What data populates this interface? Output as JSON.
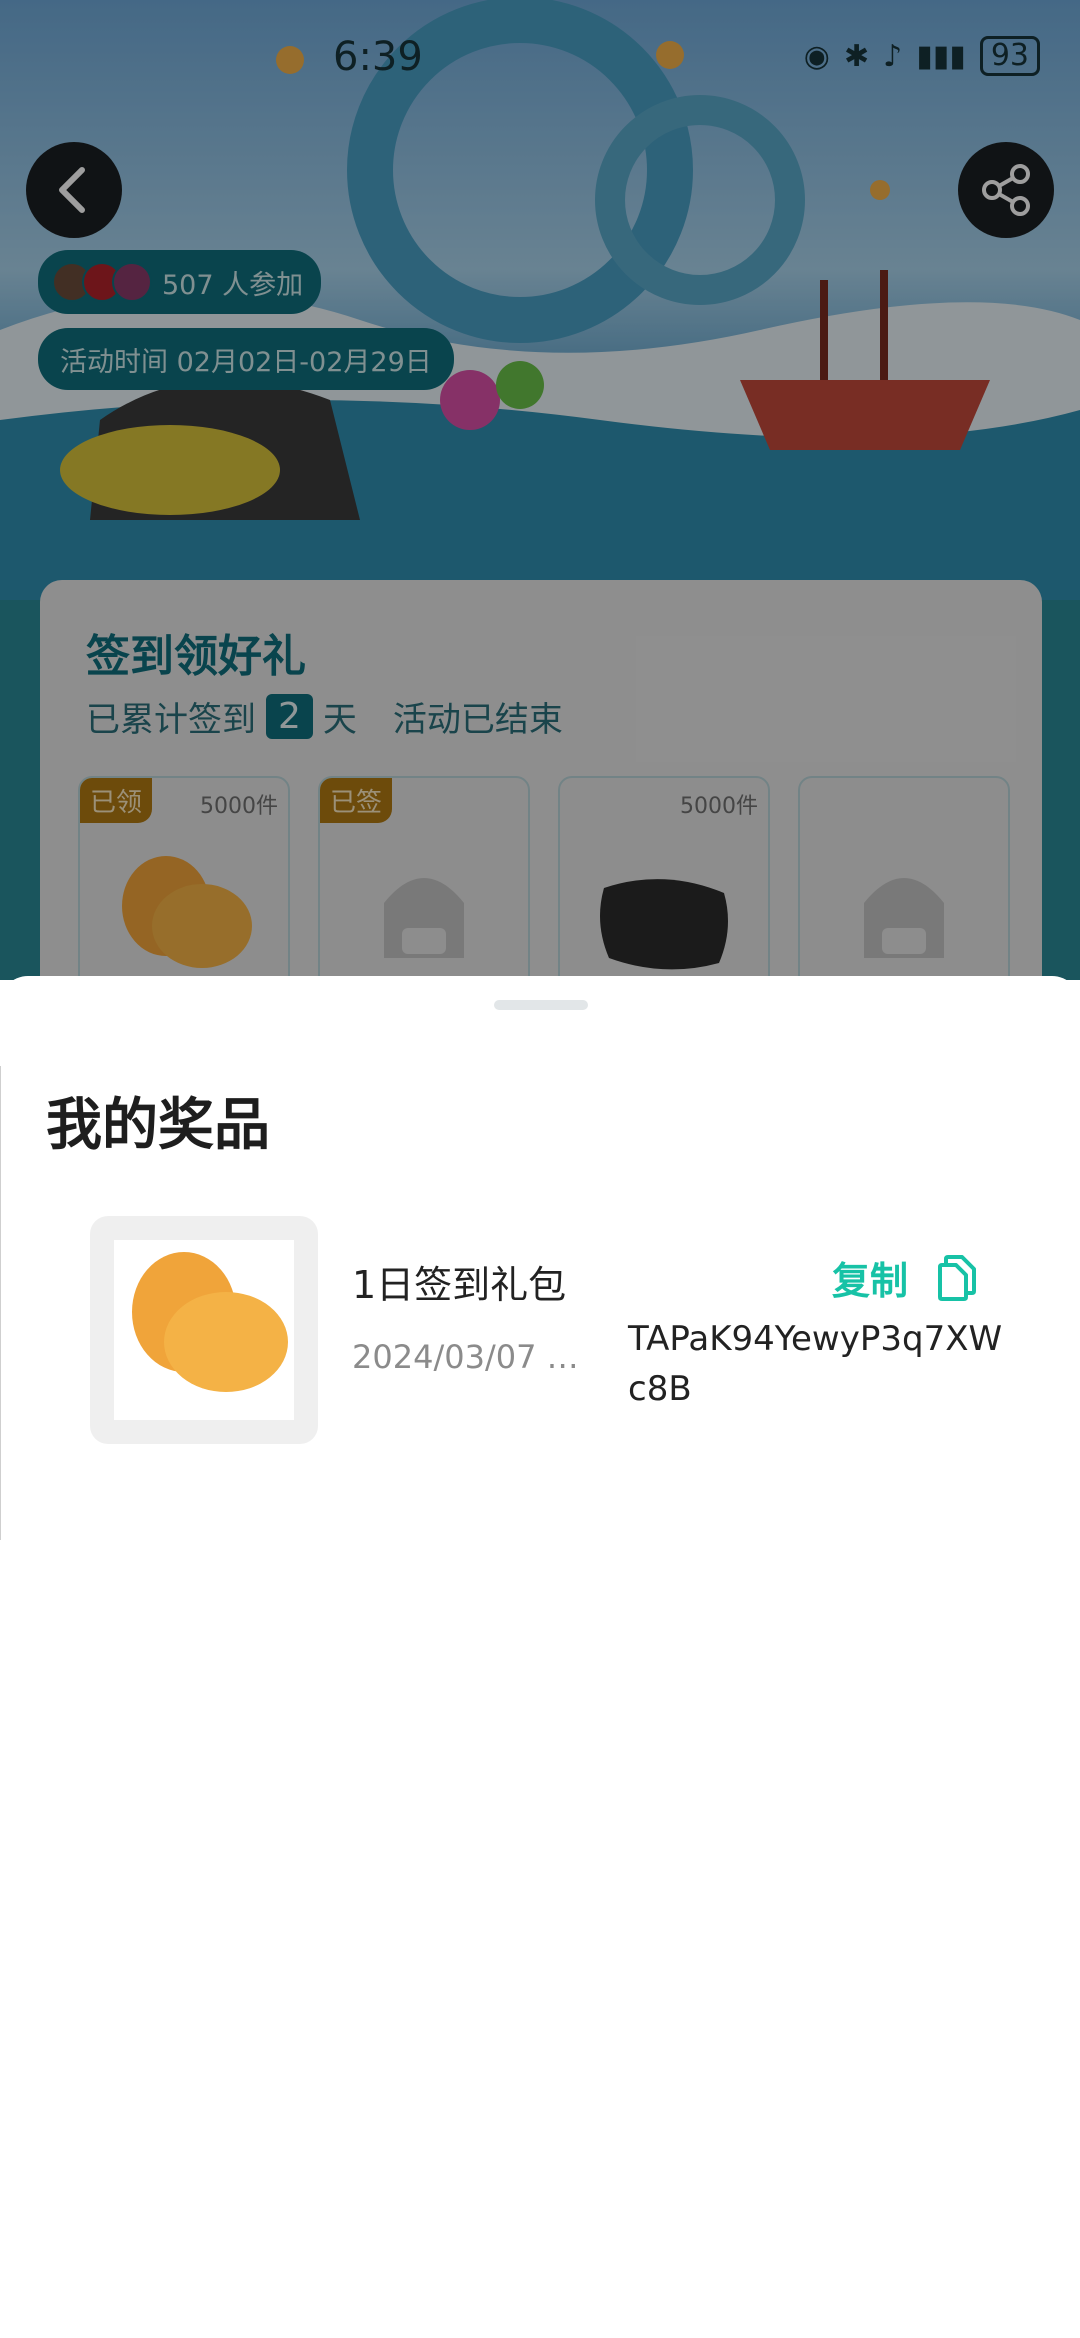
{
  "status_bar": {
    "time": "6:39",
    "battery": "93"
  },
  "header": {
    "participants": "507 人参加",
    "period": "活动时间 02月02日-02月29日"
  },
  "checkin": {
    "title": "签到领好礼",
    "prefix": "已累计签到",
    "days": "2",
    "suffix": "天",
    "status": "活动已结束",
    "slots": [
      {
        "badge": "已领",
        "count": "5000件",
        "item": "orange-candy"
      },
      {
        "badge": "已签",
        "count": "",
        "item": "locked-placeholder"
      },
      {
        "badge": "",
        "count": "5000件",
        "item": "dark-pillow"
      },
      {
        "badge": "",
        "count": "",
        "item": "locked-placeholder"
      }
    ]
  },
  "sheet": {
    "title": "我的奖品",
    "prizes": [
      {
        "name": "1日签到礼包",
        "date": "2024/03/07 …",
        "copy_label": "复制",
        "code": "TAPaK94YewyP3q7XWc8B"
      }
    ]
  },
  "colors": {
    "accent": "#17c2a6",
    "teal": "#0f6f7d",
    "badge": "#b07a12"
  }
}
